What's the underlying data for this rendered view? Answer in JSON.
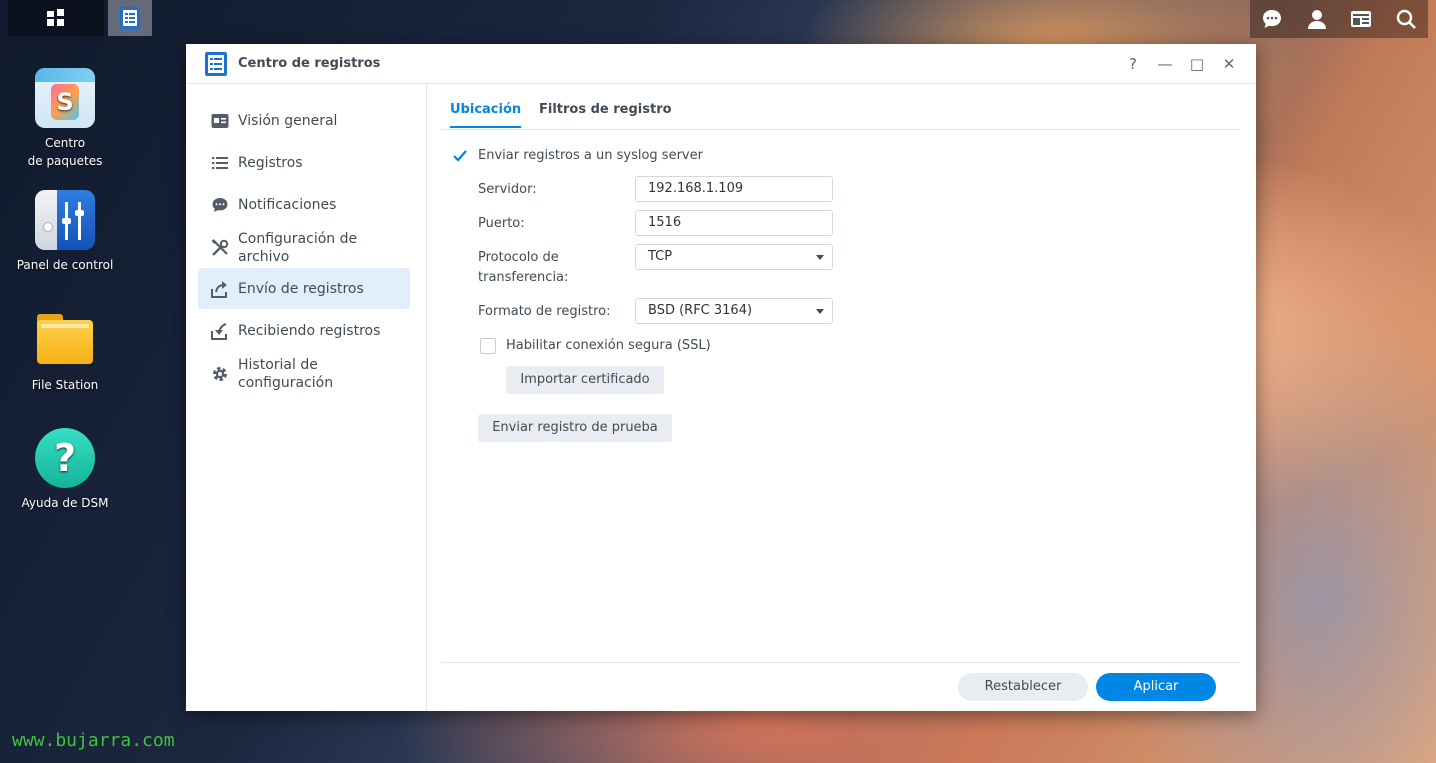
{
  "taskbar": {
    "left": [
      {
        "icon": "main-menu-grid-icon"
      },
      {
        "icon": "log-center-app-icon",
        "active": true
      }
    ],
    "right": [
      {
        "icon": "chat-icon"
      },
      {
        "icon": "user-icon"
      },
      {
        "icon": "widgets-icon"
      },
      {
        "icon": "search-icon"
      }
    ]
  },
  "desktop": {
    "icons": [
      {
        "label_line1": "Centro",
        "label_line2": "de paquetes",
        "icon": "package-center-icon"
      },
      {
        "label_line1": "Panel de control",
        "label_line2": "",
        "icon": "control-panel-icon"
      },
      {
        "label_line1": "File Station",
        "label_line2": "",
        "icon": "file-station-icon"
      },
      {
        "label_line1": "Ayuda de DSM",
        "label_line2": "",
        "icon": "dsm-help-icon"
      }
    ],
    "watermark": "www.bujarra.com"
  },
  "window": {
    "title": "Centro de registros",
    "controls": {
      "help": "?",
      "minimize": "—",
      "maximize": "□",
      "close": "✕"
    }
  },
  "sidebar": {
    "items": [
      {
        "label": "Visión general",
        "icon": "overview-icon"
      },
      {
        "label": "Registros",
        "icon": "list-icon"
      },
      {
        "label": "Notificaciones",
        "icon": "chat-bubble-icon"
      },
      {
        "label_line1": "Configuración de",
        "label_line2": "archivo",
        "icon": "tools-icon"
      },
      {
        "label": "Envío de registros",
        "icon": "send-icon",
        "selected": true
      },
      {
        "label": "Recibiendo registros",
        "icon": "receive-icon"
      },
      {
        "label_line1": "Historial de",
        "label_line2": "configuración",
        "icon": "gear-icon"
      }
    ]
  },
  "tabs": [
    {
      "label": "Ubicación",
      "active": true
    },
    {
      "label": "Filtros de registro",
      "active": false
    }
  ],
  "form": {
    "send_logs": {
      "label": "Enviar registros a un syslog server",
      "checked": true
    },
    "server": {
      "label": "Servidor:",
      "value": "192.168.1.109"
    },
    "port": {
      "label": "Puerto:",
      "value": "1516"
    },
    "protocol": {
      "label_line1": "Protocolo de",
      "label_line2": "transferencia:",
      "value": "TCP"
    },
    "format": {
      "label": "Formato de registro:",
      "value": "BSD (RFC 3164)"
    },
    "ssl": {
      "label": "Habilitar conexión segura (SSL)",
      "checked": false
    },
    "import_cert": "Importar certificado",
    "send_test": "Enviar registro de prueba"
  },
  "footer": {
    "reset": "Restablecer",
    "apply": "Aplicar"
  },
  "colors": {
    "accent": "#0086e5",
    "selected_bg": "#e3eefc"
  }
}
